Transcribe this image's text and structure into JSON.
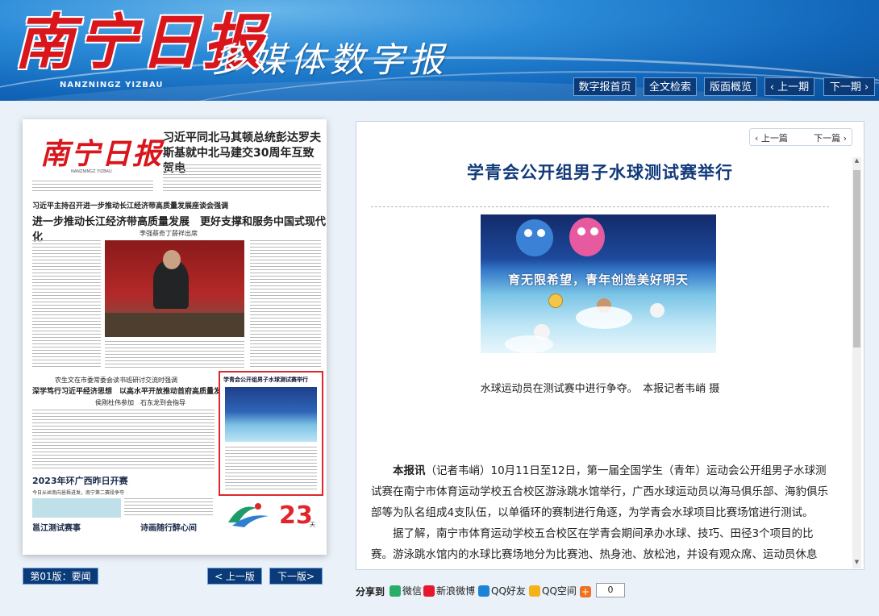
{
  "header": {
    "logo": "南宁日报",
    "logo_en": "NANZNINGZ YIZBAU",
    "slogan": "多媒体数字报",
    "nav": [
      "数字报首页",
      "全文检索",
      "版面概览",
      "‹ 上一期",
      "下一期 ›"
    ]
  },
  "paper": {
    "logo": "南宁日报",
    "logo_en": "NANZNINGZ YIZBAU",
    "headline_top": "习近平同北马其顿总统彭达罗夫斯基就中北马建交30周年互致贺电",
    "kicker": "习近平主持召开进一步推动长江经济带高质量发展座谈会强调",
    "main_headline": "进一步推动长江经济带高质量发展　更好支撑和服务中国式现代化",
    "byline": "李强蔡奇丁薛祥出席",
    "sub_kicker": "农生文在市委常委会读书班研讨交流时强调",
    "sub_headline": "深学笃行习近平经济思想　以高水平开放推动首府高质量发展",
    "sub_byline": "侯刚杜伟参加　石东龙到会指导",
    "box_title": "学青会公开组男子水球测试赛举行",
    "tour_title": "2023年环广西昨日开赛",
    "tour_sub": "今日从丝南向邕梧进发，南宁第二赛段争夺",
    "bottom_left": "邕江测试赛事",
    "bottom_mid": "诗画随行醉心间",
    "countdown": "23",
    "countdown_unit": "天"
  },
  "page_nav": {
    "current": "第01版：要闻",
    "prev": "< 上一版",
    "next": "下一版>"
  },
  "article": {
    "nav_prev": "‹ 上一篇",
    "nav_next": "下一篇 ›",
    "title": "学青会公开组男子水球测试赛举行",
    "photo_banner": "育无限希望，青年创造美好明天",
    "caption": "水球运动员在测试赛中进行争夺。　本报记者韦峭 摄",
    "lead": "本报讯",
    "p1_rest": "（记者韦峭）10月11日至12日，第一届全国学生（青年）运动会公开组男子水球测试赛在南宁市体育运动学校五合校区游泳跳水馆举行，广西水球运动员以海马俱乐部、海豹俱乐部等为队名组成4支队伍，以单循环的赛制进行角逐，为学青会水球项目比赛场馆进行测试。",
    "p2": "据了解，南宁市体育运动学校五合校区在学青会期间承办水球、技巧、田径3个项目的比赛。游泳跳水馆内的水球比赛场地分为比赛池、热身池、放松池，并设有观众席、运动员休息室、医疗室等功能区。"
  },
  "share": {
    "label": "分享到",
    "items": [
      "微信",
      "新浪微博",
      "QQ好友",
      "QQ空间"
    ],
    "count": "0"
  },
  "colors": {
    "title_blue": "#123a7a",
    "nav_bg": "#0a3a78",
    "logo_red": "#d8161c",
    "highlight_red": "#e0262a"
  }
}
